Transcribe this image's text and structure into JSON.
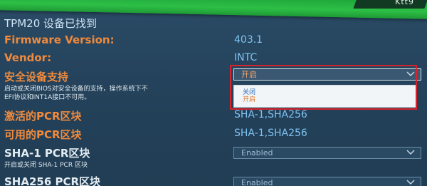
{
  "banner": {
    "corner_text": "Ktt9"
  },
  "header": {
    "title": "TPM20 设备已找到"
  },
  "fields": {
    "firmware_label": "Firmware Version:",
    "firmware_value": "403.1",
    "vendor_label": "Vendor:",
    "vendor_value": "INTC",
    "secure_device_label": "安全设备支持",
    "secure_device_desc_line1": "启动或关闭BIOS对安全设备的支持，操作系统下不",
    "secure_device_desc_line2": "EFI协议和INT1A接口不可用。",
    "secure_device_selected": "开启",
    "active_pcr_label": "激活的PCR区块",
    "active_pcr_value": "SHA-1,SHA256",
    "available_pcr_label": "可用的PCR区块",
    "available_pcr_value": "SHA-1,SHA256",
    "sha1_pcr_label": "SHA-1 PCR区块",
    "sha1_pcr_desc": "开启或关闭 SHA-1 PCR 区块",
    "sha1_pcr_selected": "Enabled",
    "sha256_pcr_label": "SHA256 PCR区块",
    "sha256_pcr_selected": "Enabled"
  },
  "dropdown": {
    "options": [
      "关闭",
      "开启"
    ]
  },
  "colors": {
    "background": "#26445d",
    "label_orange": "#f08a3c",
    "value_blue": "#7fc3f2",
    "banner_green": "#2dbf46",
    "highlight_red": "#d9232a"
  },
  "icons": {
    "dropdown_arrow": "chevron-down-icon"
  }
}
